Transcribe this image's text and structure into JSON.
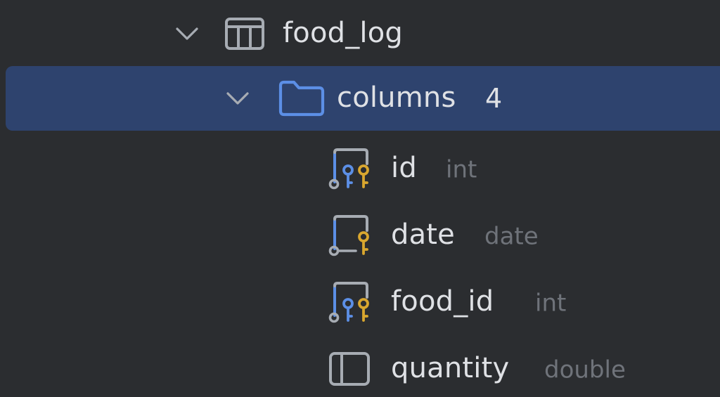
{
  "tree": {
    "table": {
      "name": "food_log",
      "icon": "table-icon",
      "expanded": true
    },
    "folder": {
      "name": "columns",
      "count": "4",
      "icon": "folder-icon",
      "expanded": true,
      "selected": true
    },
    "columns": [
      {
        "name": "id",
        "type": "int",
        "icon": "primary-foreign-key-column-icon"
      },
      {
        "name": "date",
        "type": "date",
        "icon": "indexed-key-column-icon"
      },
      {
        "name": "food_id",
        "type": "int",
        "icon": "primary-foreign-key-column-icon"
      },
      {
        "name": "quantity",
        "type": "double",
        "icon": "column-icon"
      }
    ]
  },
  "colors": {
    "background": "#2b2d30",
    "selection": "#2e436e",
    "text": "#dfe1e5",
    "muted_text": "#6f737a",
    "blue_icon": "#5c8fe6",
    "gold_icon": "#d9a72f",
    "grey_icon": "#a7acb3"
  }
}
